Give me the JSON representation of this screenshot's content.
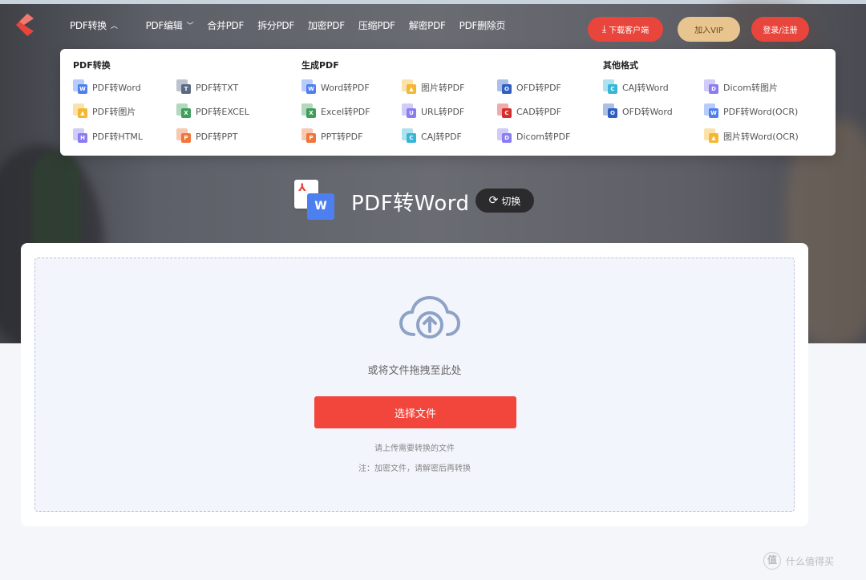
{
  "header": {
    "nav": [
      {
        "label": "PDF转换",
        "caret": "up"
      },
      {
        "label": "PDF编辑",
        "caret": "down"
      },
      {
        "label": "合并PDF"
      },
      {
        "label": "拆分PDF"
      },
      {
        "label": "加密PDF"
      },
      {
        "label": "压缩PDF"
      },
      {
        "label": "解密PDF"
      },
      {
        "label": "PDF删除页"
      }
    ],
    "download_label": "下载客户端",
    "vip_label": "加入VIP",
    "login_label": "登录/注册",
    "logo_color": "#e8453c"
  },
  "dropdown": {
    "sections": [
      {
        "title": "PDF转换"
      },
      {
        "title": "生成PDF"
      },
      {
        "title": "其他格式"
      }
    ],
    "items": [
      {
        "label": "PDF转Word",
        "icon": "word-icon",
        "color": "#4e7ff0",
        "glyph": "W"
      },
      {
        "label": "PDF转TXT",
        "icon": "txt-icon",
        "color": "#5a6a85",
        "glyph": "T"
      },
      {
        "label": "PDF转图片",
        "icon": "image-icon",
        "color": "#f5b731",
        "glyph": "▲"
      },
      {
        "label": "PDF转EXCEL",
        "icon": "excel-icon",
        "color": "#3e9e5a",
        "glyph": "X"
      },
      {
        "label": "PDF转HTML",
        "icon": "html-icon",
        "color": "#8a7df0",
        "glyph": "H"
      },
      {
        "label": "PDF转PPT",
        "icon": "ppt-icon",
        "color": "#f0763c",
        "glyph": "P"
      },
      {
        "label": "Word转PDF",
        "icon": "word-icon",
        "color": "#4e7ff0",
        "glyph": "W"
      },
      {
        "label": "图片转PDF",
        "icon": "image-icon",
        "color": "#f5b731",
        "glyph": "▲"
      },
      {
        "label": "OFD转PDF",
        "icon": "ofd-icon",
        "color": "#2e5fc2",
        "glyph": "O"
      },
      {
        "label": "Excel转PDF",
        "icon": "excel-icon",
        "color": "#3e9e5a",
        "glyph": "X"
      },
      {
        "label": "URL转PDF",
        "icon": "url-icon",
        "color": "#8a7df0",
        "glyph": "U"
      },
      {
        "label": "CAD转PDF",
        "icon": "cad-icon",
        "color": "#d62d2d",
        "glyph": "C"
      },
      {
        "label": "PPT转PDF",
        "icon": "ppt-icon",
        "color": "#f0763c",
        "glyph": "P"
      },
      {
        "label": "CAJ转PDF",
        "icon": "caj-icon",
        "color": "#38b6d8",
        "glyph": "C"
      },
      {
        "label": "Dicom转PDF",
        "icon": "dicom-icon",
        "color": "#8a7df0",
        "glyph": "D"
      },
      {
        "label": "CAJ转Word",
        "icon": "caj-icon",
        "color": "#38b6d8",
        "glyph": "C"
      },
      {
        "label": "Dicom转图片",
        "icon": "dicom-icon",
        "color": "#8a7df0",
        "glyph": "D"
      },
      {
        "label": "OFD转Word",
        "icon": "ofd-icon",
        "color": "#2e5fc2",
        "glyph": "O"
      },
      {
        "label": "PDF转Word(OCR)",
        "icon": "word-ocr-icon",
        "color": "#4e7ff0",
        "glyph": "W"
      },
      {
        "label": "图片转Word(OCR)",
        "icon": "image-ocr-icon",
        "color": "#f5b731",
        "glyph": "▲"
      }
    ]
  },
  "main": {
    "title": "PDF转Word",
    "switch_label": "切换",
    "drag_text": "或将文件拖拽至此处",
    "choose_label": "选择文件",
    "hint1": "请上传需要转换的文件",
    "hint2": "注：加密文件，请解密后再转换"
  },
  "watermark": {
    "badge": "值",
    "text": "什么值得买"
  }
}
